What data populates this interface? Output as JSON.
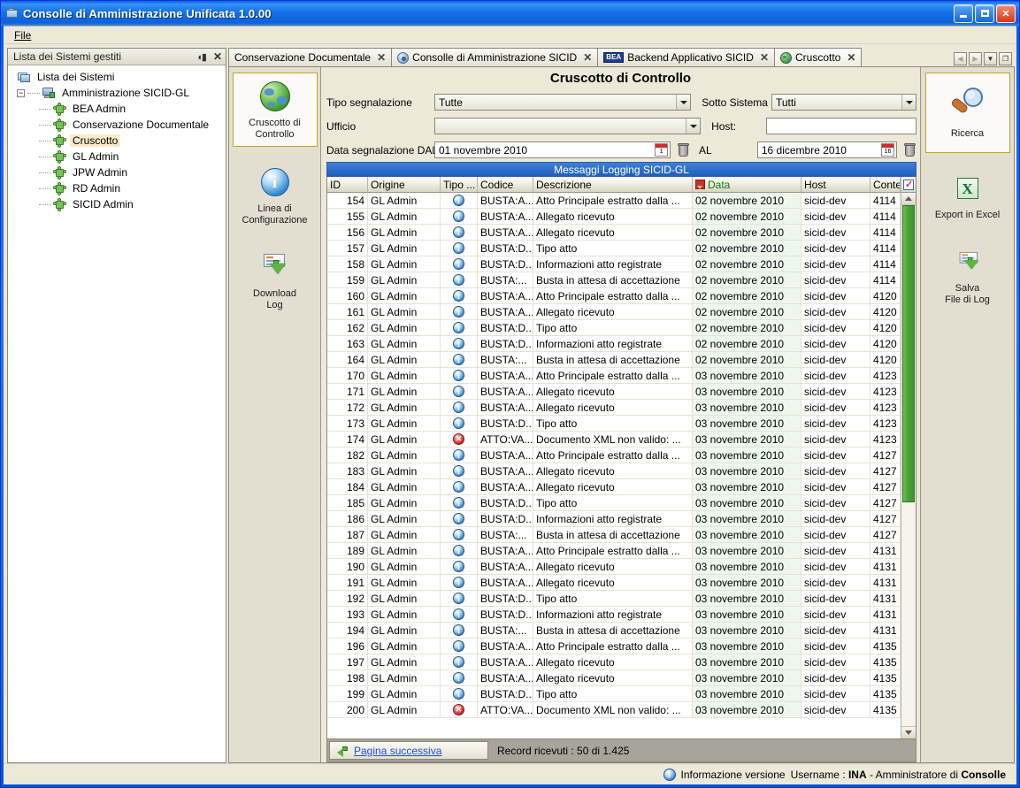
{
  "window": {
    "title": "Consolle di Amministrazione Unificata 1.0.00",
    "icon": "app-folder-icon",
    "minimize_label": "_",
    "maximize_label": "□",
    "close_label": "✕"
  },
  "menubar": {
    "items": [
      {
        "label": "File"
      }
    ]
  },
  "left_panel": {
    "header": "Lista dei Sistemi gestiti",
    "pin_icon": "auto-hide-pin-icon",
    "close_icon": "close-icon",
    "tree": {
      "root": {
        "label": "Lista dei Sistemi",
        "icon": "systems-list-icon"
      },
      "group": {
        "label": "Amministrazione SICID-GL",
        "icon": "server-icon",
        "expander": "−"
      },
      "children": [
        {
          "label": "BEA Admin",
          "selected": false
        },
        {
          "label": "Conservazione Documentale",
          "selected": false
        },
        {
          "label": "Cruscotto",
          "selected": true
        },
        {
          "label": "GL Admin",
          "selected": false
        },
        {
          "label": "JPW Admin",
          "selected": false
        },
        {
          "label": "RD Admin",
          "selected": false
        },
        {
          "label": "SICID Admin",
          "selected": false
        }
      ]
    }
  },
  "tabs": {
    "items": [
      {
        "label": "Conservazione Documentale",
        "icon": "none",
        "active": false,
        "close": "✕"
      },
      {
        "label": "Consolle di Amministrazione SICID",
        "icon": "disc-icon",
        "active": false,
        "close": "✕"
      },
      {
        "label": "Backend Applicativo SICID",
        "icon": "bea-badge-icon",
        "badge": "BEA",
        "active": false,
        "close": "✕"
      },
      {
        "label": "Cruscotto",
        "icon": "globe-icon",
        "active": true,
        "close": "✕"
      }
    ],
    "nav": {
      "prev": "◀",
      "next": "▶",
      "list": "▼",
      "window": "❐"
    }
  },
  "sidebar": {
    "items": [
      {
        "label": "Cruscotto di\nControllo",
        "label_line1": "Cruscotto di",
        "label_line2": "Controllo",
        "icon": "globe-icon",
        "active": true
      },
      {
        "label_line1": "Linea di",
        "label_line2": "Configurazione",
        "icon": "info-icon",
        "active": false
      },
      {
        "label_line1": "Download",
        "label_line2": "Log",
        "icon": "download-log-icon",
        "active": false
      }
    ]
  },
  "main": {
    "page_title": "Cruscotto di Controllo",
    "filters": {
      "tipo_segnalazione": {
        "label": "Tipo segnalazione",
        "value": "Tutte"
      },
      "sotto_sistema": {
        "label": "Sotto Sistema",
        "value": "Tutti"
      },
      "ufficio": {
        "label": "Ufficio",
        "value": ""
      },
      "host": {
        "label": "Host:",
        "value": ""
      },
      "data_dal": {
        "label": "Data segnalazione DAL",
        "value": "01 novembre 2010",
        "cal_day": "1",
        "clear_icon": "trash-icon"
      },
      "data_al": {
        "label": "AL",
        "value": "16 dicembre 2010",
        "cal_day": "16",
        "clear_icon": "trash-icon"
      }
    },
    "grid": {
      "caption": "Messaggi Logging SICID-GL",
      "columns": [
        "ID",
        "Origine",
        "Tipo ...",
        "Codice",
        "Descrizione",
        "Data",
        "Host",
        "Contesto"
      ],
      "sorted_column": "Data",
      "column_chooser_icon": "column-chooser-icon",
      "rows": [
        [
          "154",
          "GL Admin",
          "info",
          "BUSTA:A...",
          "Atto Principale estratto dalla ...",
          "02 novembre 2010",
          "sicid-dev",
          "4114"
        ],
        [
          "155",
          "GL Admin",
          "info",
          "BUSTA:A...",
          "Allegato ricevuto",
          "02 novembre 2010",
          "sicid-dev",
          "4114"
        ],
        [
          "156",
          "GL Admin",
          "info",
          "BUSTA:A...",
          "Allegato ricevuto",
          "02 novembre 2010",
          "sicid-dev",
          "4114"
        ],
        [
          "157",
          "GL Admin",
          "info",
          "BUSTA:D...",
          "Tipo atto",
          "02 novembre 2010",
          "sicid-dev",
          "4114"
        ],
        [
          "158",
          "GL Admin",
          "info",
          "BUSTA:D...",
          "Informazioni atto registrate",
          "02 novembre 2010",
          "sicid-dev",
          "4114"
        ],
        [
          "159",
          "GL Admin",
          "info",
          "BUSTA:...",
          "Busta in attesa di accettazione",
          "02 novembre 2010",
          "sicid-dev",
          "4114"
        ],
        [
          "160",
          "GL Admin",
          "info",
          "BUSTA:A...",
          "Atto Principale estratto dalla ...",
          "02 novembre 2010",
          "sicid-dev",
          "4120"
        ],
        [
          "161",
          "GL Admin",
          "info",
          "BUSTA:A...",
          "Allegato ricevuto",
          "02 novembre 2010",
          "sicid-dev",
          "4120"
        ],
        [
          "162",
          "GL Admin",
          "info",
          "BUSTA:D...",
          "Tipo atto",
          "02 novembre 2010",
          "sicid-dev",
          "4120"
        ],
        [
          "163",
          "GL Admin",
          "info",
          "BUSTA:D...",
          "Informazioni atto registrate",
          "02 novembre 2010",
          "sicid-dev",
          "4120"
        ],
        [
          "164",
          "GL Admin",
          "info",
          "BUSTA:...",
          "Busta in attesa di accettazione",
          "02 novembre 2010",
          "sicid-dev",
          "4120"
        ],
        [
          "170",
          "GL Admin",
          "info",
          "BUSTA:A...",
          "Atto Principale estratto dalla ...",
          "03 novembre 2010",
          "sicid-dev",
          "4123"
        ],
        [
          "171",
          "GL Admin",
          "info",
          "BUSTA:A...",
          "Allegato ricevuto",
          "03 novembre 2010",
          "sicid-dev",
          "4123"
        ],
        [
          "172",
          "GL Admin",
          "info",
          "BUSTA:A...",
          "Allegato ricevuto",
          "03 novembre 2010",
          "sicid-dev",
          "4123"
        ],
        [
          "173",
          "GL Admin",
          "info",
          "BUSTA:D...",
          "Tipo atto",
          "03 novembre 2010",
          "sicid-dev",
          "4123"
        ],
        [
          "174",
          "GL Admin",
          "error",
          "ATTO:VA...",
          "Documento XML non valido: ...",
          "03 novembre 2010",
          "sicid-dev",
          "4123"
        ],
        [
          "182",
          "GL Admin",
          "info",
          "BUSTA:A...",
          "Atto Principale estratto dalla ...",
          "03 novembre 2010",
          "sicid-dev",
          "4127"
        ],
        [
          "183",
          "GL Admin",
          "info",
          "BUSTA:A...",
          "Allegato ricevuto",
          "03 novembre 2010",
          "sicid-dev",
          "4127"
        ],
        [
          "184",
          "GL Admin",
          "info",
          "BUSTA:A...",
          "Allegato ricevuto",
          "03 novembre 2010",
          "sicid-dev",
          "4127"
        ],
        [
          "185",
          "GL Admin",
          "info",
          "BUSTA:D...",
          "Tipo atto",
          "03 novembre 2010",
          "sicid-dev",
          "4127"
        ],
        [
          "186",
          "GL Admin",
          "info",
          "BUSTA:D...",
          "Informazioni atto registrate",
          "03 novembre 2010",
          "sicid-dev",
          "4127"
        ],
        [
          "187",
          "GL Admin",
          "info",
          "BUSTA:...",
          "Busta in attesa di accettazione",
          "03 novembre 2010",
          "sicid-dev",
          "4127"
        ],
        [
          "189",
          "GL Admin",
          "info",
          "BUSTA:A...",
          "Atto Principale estratto dalla ...",
          "03 novembre 2010",
          "sicid-dev",
          "4131"
        ],
        [
          "190",
          "GL Admin",
          "info",
          "BUSTA:A...",
          "Allegato ricevuto",
          "03 novembre 2010",
          "sicid-dev",
          "4131"
        ],
        [
          "191",
          "GL Admin",
          "info",
          "BUSTA:A...",
          "Allegato ricevuto",
          "03 novembre 2010",
          "sicid-dev",
          "4131"
        ],
        [
          "192",
          "GL Admin",
          "info",
          "BUSTA:D...",
          "Tipo atto",
          "03 novembre 2010",
          "sicid-dev",
          "4131"
        ],
        [
          "193",
          "GL Admin",
          "info",
          "BUSTA:D...",
          "Informazioni atto registrate",
          "03 novembre 2010",
          "sicid-dev",
          "4131"
        ],
        [
          "194",
          "GL Admin",
          "info",
          "BUSTA:...",
          "Busta in attesa di accettazione",
          "03 novembre 2010",
          "sicid-dev",
          "4131"
        ],
        [
          "196",
          "GL Admin",
          "info",
          "BUSTA:A...",
          "Atto Principale estratto dalla ...",
          "03 novembre 2010",
          "sicid-dev",
          "4135"
        ],
        [
          "197",
          "GL Admin",
          "info",
          "BUSTA:A...",
          "Allegato ricevuto",
          "03 novembre 2010",
          "sicid-dev",
          "4135"
        ],
        [
          "198",
          "GL Admin",
          "info",
          "BUSTA:A...",
          "Allegato ricevuto",
          "03 novembre 2010",
          "sicid-dev",
          "4135"
        ],
        [
          "199",
          "GL Admin",
          "info",
          "BUSTA:D...",
          "Tipo atto",
          "03 novembre 2010",
          "sicid-dev",
          "4135"
        ],
        [
          "200",
          "GL Admin",
          "error",
          "ATTO:VA...",
          "Documento XML non valido: ...",
          "03 novembre 2010",
          "sicid-dev",
          "4135"
        ]
      ]
    },
    "bottom": {
      "next_page_label": "Pagina successiva",
      "next_page_icon": "green-arrow-icon",
      "record_count": "Record ricevuti : 50 di 1.425"
    }
  },
  "actions": {
    "items": [
      {
        "label": "Ricerca",
        "icon": "magnifier-icon",
        "active": true
      },
      {
        "label_line1": "Export in Excel",
        "icon": "excel-icon",
        "active": false
      },
      {
        "label_line1": "Salva",
        "label_line2": "File di Log",
        "icon": "save-log-icon",
        "active": false
      }
    ]
  },
  "statusbar": {
    "info_icon": "info-icon",
    "version_label": "Informazione versione",
    "username_prefix": "Username :",
    "username": "INA",
    "role_sep": "- Amministratore di",
    "role": "Consolle"
  },
  "colors": {
    "titlebar_blue": "#0f63e0",
    "window_face": "#ece9d8",
    "grid_caption": "#2f6fc4",
    "scrollbar_thumb_green": "#4ea33c",
    "date_col_bg": "#eef7ee",
    "selection_highlight": "#faecc8",
    "active_action_border": "#c9a227",
    "link_blue": "#1d4ed8"
  }
}
